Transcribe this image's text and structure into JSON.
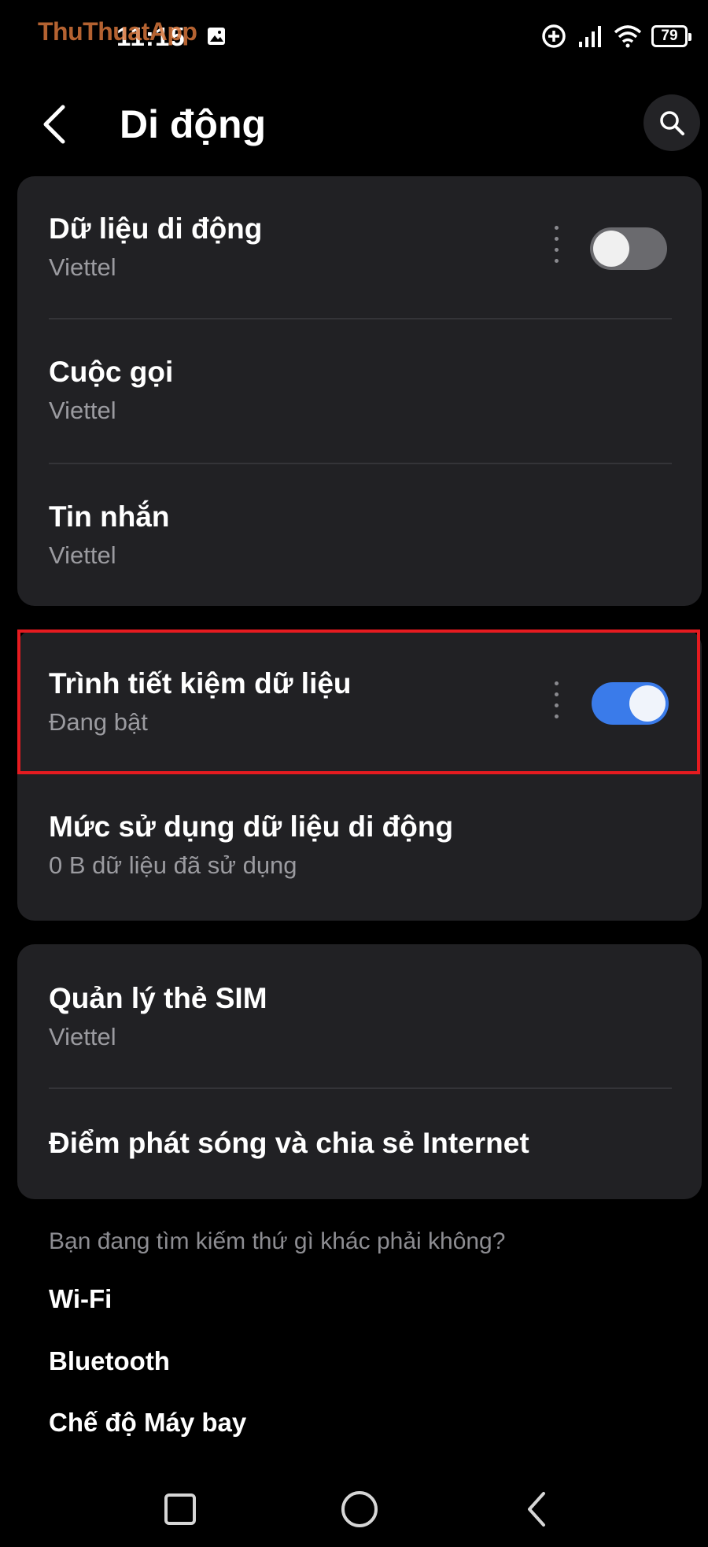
{
  "status_bar": {
    "time": "11:15",
    "watermark": "ThuThuatApp",
    "battery": "79",
    "icons": [
      "image-notification-icon",
      "data-saver-icon",
      "signal-icon",
      "wifi-icon",
      "battery-icon"
    ]
  },
  "header": {
    "title": "Di động",
    "icons": [
      "back-arrow-icon",
      "search-icon"
    ]
  },
  "card1": {
    "items": [
      {
        "title": "Dữ liệu di động",
        "subtitle": "Viettel",
        "toggle": "off"
      },
      {
        "title": "Cuộc gọi",
        "subtitle": "Viettel"
      },
      {
        "title": "Tin nhắn",
        "subtitle": "Viettel"
      }
    ]
  },
  "card2": {
    "items": [
      {
        "title": "Trình tiết kiệm dữ liệu",
        "subtitle": "Đang bật",
        "toggle": "on"
      },
      {
        "title": "Mức sử dụng dữ liệu di động",
        "subtitle": "0 B dữ liệu đã sử dụng"
      }
    ]
  },
  "card3": {
    "items": [
      {
        "title": "Quản lý thẻ SIM",
        "subtitle": "Viettel"
      },
      {
        "title": "Điểm phát sóng và chia sẻ Internet"
      }
    ]
  },
  "suggestions": {
    "label": "Bạn đang tìm kiếm thứ gì khác phải không?",
    "links": [
      "Wi-Fi",
      "Bluetooth",
      "Chế độ Máy bay"
    ]
  },
  "nav_bar": {
    "icons": [
      "recent-apps-icon",
      "home-icon",
      "back-icon"
    ]
  },
  "colors": {
    "background": "#000000",
    "card": "#212124",
    "accent_toggle_on": "#3a7bea",
    "highlight_border": "#e51b20",
    "subtitle_text": "#9b9ba0"
  }
}
